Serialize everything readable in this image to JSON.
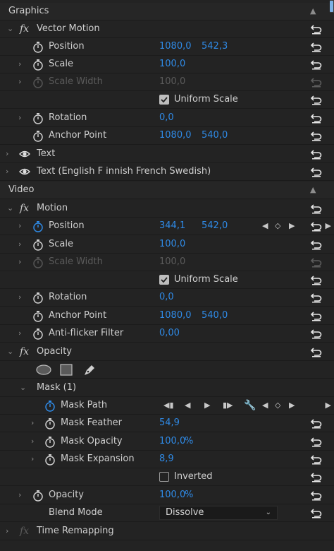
{
  "sections": {
    "graphics": "Graphics",
    "video": "Video"
  },
  "graphics": {
    "vector_motion": "Vector Motion",
    "position": {
      "label": "Position",
      "x": "1080,0",
      "y": "542,3"
    },
    "scale": {
      "label": "Scale",
      "value": "100,0"
    },
    "scale_width": {
      "label": "Scale Width",
      "value": "100,0"
    },
    "uniform_scale": {
      "label": "Uniform Scale",
      "checked": true
    },
    "rotation": {
      "label": "Rotation",
      "value": "0,0"
    },
    "anchor_point": {
      "label": "Anchor Point",
      "x": "1080,0",
      "y": "540,0"
    },
    "text1": "Text",
    "text2": "Text (English F innish French Swedish)"
  },
  "video": {
    "motion": "Motion",
    "position": {
      "label": "Position",
      "x": "344,1",
      "y": "542,0"
    },
    "scale": {
      "label": "Scale",
      "value": "100,0"
    },
    "scale_width": {
      "label": "Scale Width",
      "value": "100,0"
    },
    "uniform_scale": {
      "label": "Uniform Scale",
      "checked": true
    },
    "rotation": {
      "label": "Rotation",
      "value": "0,0"
    },
    "anchor_point": {
      "label": "Anchor Point",
      "x": "1080,0",
      "y": "540,0"
    },
    "anti_flicker": {
      "label": "Anti-flicker Filter",
      "value": "0,00"
    },
    "opacity_effect": "Opacity",
    "mask": "Mask (1)",
    "mask_path": "Mask Path",
    "mask_feather": {
      "label": "Mask Feather",
      "value": "54,9"
    },
    "mask_opacity": {
      "label": "Mask Opacity",
      "value": "100,0",
      "unit": "%"
    },
    "mask_expansion": {
      "label": "Mask Expansion",
      "value": "8,9"
    },
    "inverted": {
      "label": "Inverted",
      "checked": false
    },
    "opacity": {
      "label": "Opacity",
      "value": "100,0",
      "unit": "%"
    },
    "blend_mode": {
      "label": "Blend Mode",
      "value": "Dissolve"
    },
    "time_remapping": "Time Remapping"
  },
  "colors": {
    "accent": "#2f8ae6",
    "background": "#232323"
  },
  "icons": {
    "reset": "reset-icon",
    "stopwatch": "stopwatch-icon",
    "eye": "eye-icon",
    "fx": "fx-icon"
  }
}
